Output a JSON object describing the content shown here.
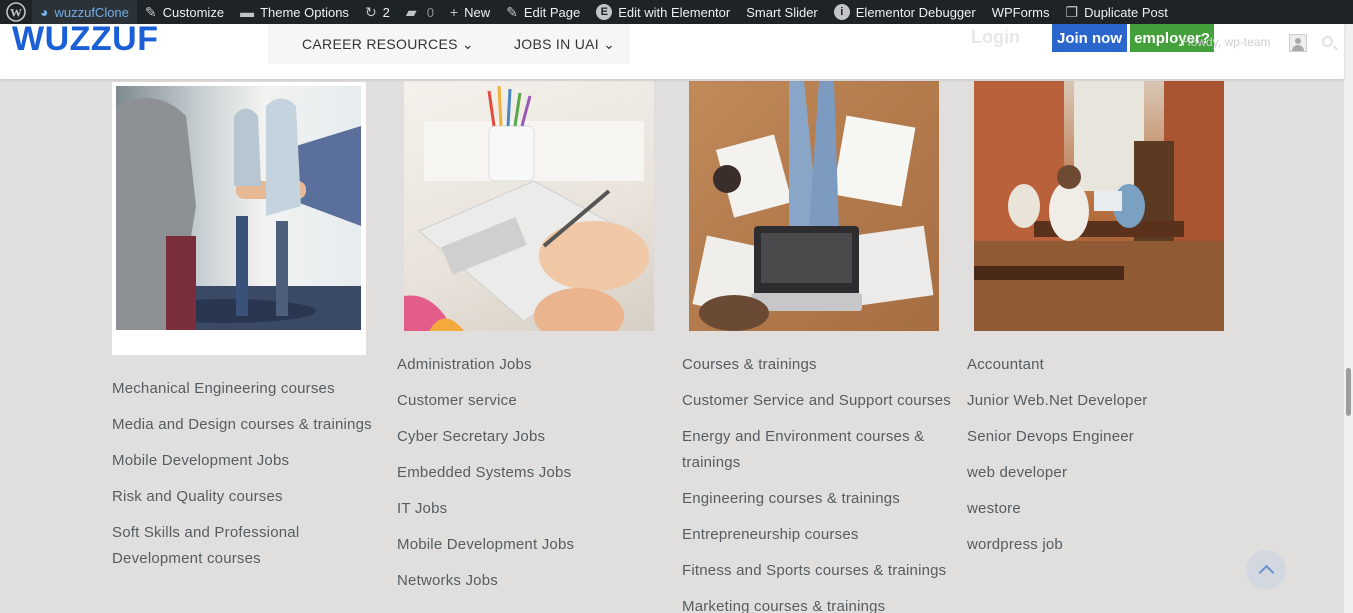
{
  "adminbar": {
    "site_name": "wuzzufClone",
    "customize": "Customize",
    "theme_options": "Theme Options",
    "updates_count": "2",
    "comments_count": "0",
    "new": "New",
    "edit_page": "Edit Page",
    "edit_elementor": "Edit with Elementor",
    "smart_slider": "Smart Slider",
    "elementor_debugger": "Elementor Debugger",
    "wpforms": "WPForms",
    "duplicate_post": "Duplicate Post"
  },
  "header": {
    "logo": "WUZZUF",
    "nav": [
      "CAREER RESOURCES",
      "JOBS IN UAI"
    ],
    "login": "Login",
    "join": "Join now",
    "employer": "employer?",
    "howdy": "Howdy, wp-team"
  },
  "columns": [
    [
      "Mechanical Engineering courses",
      "Media and Design courses & trainings",
      "Mobile Development Jobs",
      "Risk and Quality courses",
      "Soft Skills and Professional Development courses"
    ],
    [
      "Administration Jobs",
      "Customer service",
      "Cyber Secretary Jobs",
      "Embedded Systems Jobs",
      "IT Jobs",
      "Mobile Development Jobs",
      "Networks Jobs"
    ],
    [
      "Courses & trainings",
      "Customer Service and Support courses",
      "Energy and Environment courses & trainings",
      "Engineering courses & trainings",
      "Entrepreneurship courses",
      "Fitness and Sports courses & trainings",
      "Marketing courses & trainings"
    ],
    [
      "Accountant",
      "Junior Web.Net Developer",
      "Senior Devops Engineer",
      "web developer",
      "westore",
      "wordpress job"
    ]
  ]
}
